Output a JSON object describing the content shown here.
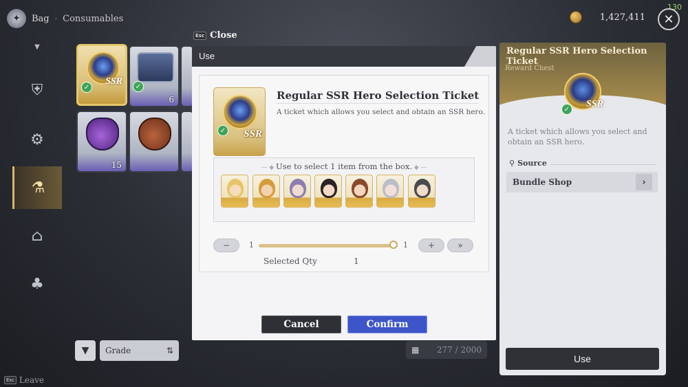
{
  "top": {
    "breadcrumb_root": "Bag",
    "breadcrumb_sep": "·",
    "breadcrumb_sub": "Consumables",
    "gold": "1,427,411",
    "fps": "130"
  },
  "icons": {
    "bag": "backpack-icon",
    "coin": "gold-coin-icon",
    "close": "close-icon"
  },
  "inventory": {
    "slots": [
      {
        "qty": "",
        "kind": "ssr-ticket"
      },
      {
        "qty": "6",
        "kind": "chest"
      },
      {
        "qty": "",
        "kind": "chest-partial"
      },
      {
        "qty": "15",
        "kind": "potion"
      },
      {
        "qty": "",
        "kind": "pouch"
      },
      {
        "qty": "",
        "kind": "partial"
      }
    ],
    "ssr_label": "SSR",
    "filter_label": "Grade",
    "capacity": "277 / 2000",
    "leave_label": "Leave",
    "esc": "Esc"
  },
  "modal": {
    "close_label": "Close",
    "title": "Use",
    "item_name": "Regular SSR Hero Selection Ticket",
    "item_desc": "A ticket which allows you select and obtain an SSR hero.",
    "select_label": "Use to select 1 item from the box.",
    "min": "1",
    "max": "1",
    "minus": "−",
    "plus": "+",
    "max_btn": "»",
    "selected_qty_label": "Selected Qty",
    "selected_qty": "1",
    "cancel": "Cancel",
    "confirm": "Confirm",
    "heroes": [
      "hero-1",
      "hero-2",
      "hero-3",
      "hero-4",
      "hero-5",
      "hero-6",
      "hero-7"
    ]
  },
  "info": {
    "title": "Regular SSR Hero Selection Ticket",
    "subtitle": "Reward Chest",
    "desc": "A ticket which allows you select and obtain an SSR hero.",
    "source_label": "Source",
    "source_item": "Bundle Shop",
    "use": "Use"
  },
  "colors": {
    "accent_gold": "#d8b66a",
    "confirm_blue": "#3d55c8",
    "check_green": "#3fa35a"
  }
}
